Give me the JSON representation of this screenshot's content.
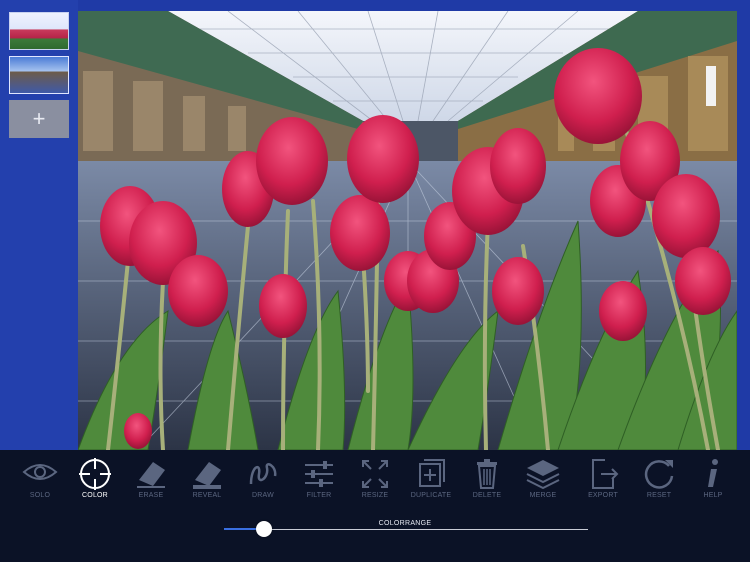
{
  "sidebar": {
    "add_layer_label": "+",
    "thumbnails": [
      "tulips-layer",
      "hall-layer"
    ]
  },
  "canvas": {
    "content": "photo-composite"
  },
  "toolbar": {
    "tools": [
      {
        "label": "SOLO",
        "icon": "eye-icon",
        "active": false
      },
      {
        "label": "COLOR",
        "icon": "crosshair-icon",
        "active": true
      },
      {
        "label": "ERASE",
        "icon": "eraser-icon",
        "active": false
      },
      {
        "label": "REVEAL",
        "icon": "reveal-icon",
        "active": false
      },
      {
        "label": "DRAW",
        "icon": "squiggle-icon",
        "active": false
      },
      {
        "label": "FILTER",
        "icon": "sliders-icon",
        "active": false
      },
      {
        "label": "RESIZE",
        "icon": "resize-icon",
        "active": false
      },
      {
        "label": "DUPLICATE",
        "icon": "duplicate-icon",
        "active": false
      },
      {
        "label": "DELETE",
        "icon": "trash-icon",
        "active": false
      },
      {
        "label": "MERGE",
        "icon": "layers-icon",
        "active": false
      },
      {
        "label": "EXPORT",
        "icon": "export-icon",
        "active": false
      },
      {
        "label": "RESET",
        "icon": "reset-icon",
        "active": false
      },
      {
        "label": "HELP",
        "icon": "info-icon",
        "active": false
      }
    ]
  },
  "slider": {
    "label": "COLORRANGE",
    "value_fraction": 0.11
  },
  "colors": {
    "background": "#1f3aa6",
    "toolbar": "#0b1226",
    "accent": "#3a6fe0"
  }
}
